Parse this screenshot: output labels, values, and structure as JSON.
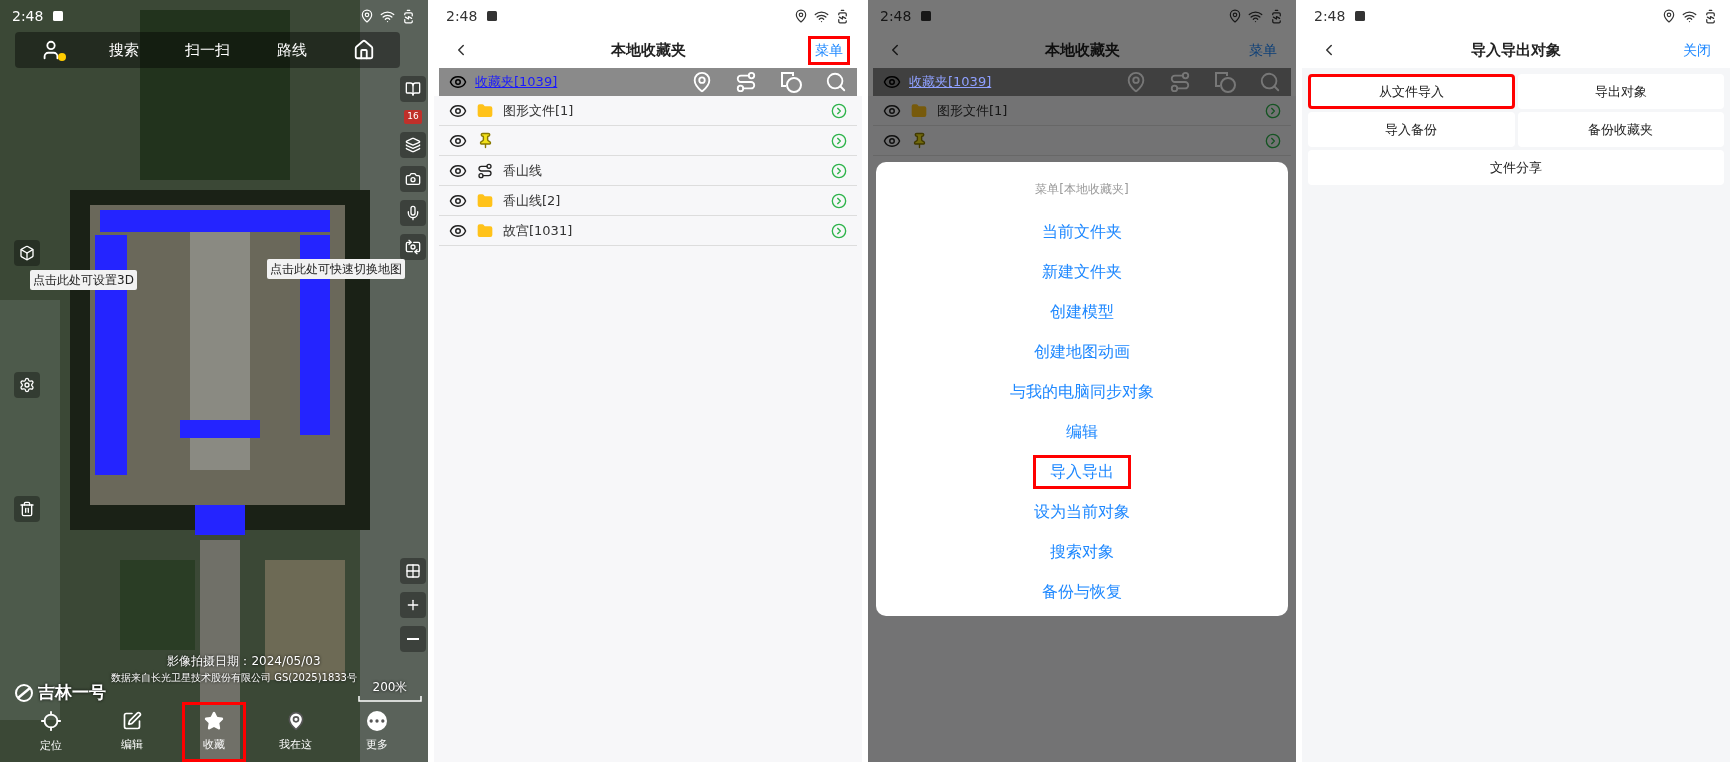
{
  "map_screen": {
    "status_bar": {
      "time": "2:48"
    },
    "top_tabs": [
      "搜索",
      "扫一扫",
      "路线"
    ],
    "zoom_badge": "16",
    "tooltips": {
      "mode_3d": "点击此处可设置3D",
      "map_switch": "点击此处可快速切换地图"
    },
    "imagery_date": "影像拍摄日期：2024/05/03",
    "credit": "数据来自长光卫星技术股份有限公司 GS(2025)1833号",
    "brand": "吉林一号",
    "scale": "200米",
    "bottom_nav": [
      {
        "kind": "locate",
        "label": "定位",
        "highlighted": false
      },
      {
        "kind": "edit",
        "label": "编辑",
        "highlighted": false
      },
      {
        "kind": "favorite",
        "label": "收藏",
        "highlighted": true
      },
      {
        "kind": "here",
        "label": "我在这",
        "highlighted": false
      },
      {
        "kind": "more",
        "label": "更多",
        "highlighted": false
      }
    ]
  },
  "favorites_screen": {
    "status_bar": {
      "time": "2:48"
    },
    "header": {
      "title": "本地收藏夹",
      "action": {
        "label": "菜单",
        "highlighted": true
      }
    },
    "folder_bar": {
      "title": "收藏夹[1039]"
    },
    "items": [
      {
        "kind": "folder",
        "label": "图形文件[1]"
      },
      {
        "kind": "pin"
      },
      {
        "kind": "route",
        "label": "香山线"
      },
      {
        "kind": "folder",
        "label": "香山线[2]"
      },
      {
        "kind": "folder",
        "label": "故宫[1031]"
      }
    ]
  },
  "menu_screen": {
    "status_bar": {
      "time": "2:48"
    },
    "header": {
      "title": "本地收藏夹",
      "action": {
        "label": "菜单",
        "highlighted": false
      }
    },
    "folder_bar": {
      "title": "收藏夹[1039]"
    },
    "items": [
      {
        "kind": "folder",
        "label": "图形文件[1]"
      },
      {
        "kind": "pin"
      }
    ],
    "menu": {
      "title": "菜单[本地收藏夹]",
      "items": [
        {
          "label": "当前文件夹",
          "highlighted": false
        },
        {
          "label": "新建文件夹",
          "highlighted": false
        },
        {
          "label": "创建模型",
          "highlighted": false
        },
        {
          "label": "创建地图动画",
          "highlighted": false
        },
        {
          "label": "与我的电脑同步对象",
          "highlighted": false
        },
        {
          "label": "编辑",
          "highlighted": false
        },
        {
          "label": "导入导出",
          "highlighted": true
        },
        {
          "label": "设为当前对象",
          "highlighted": false
        },
        {
          "label": "搜索对象",
          "highlighted": false
        },
        {
          "label": "备份与恢复",
          "highlighted": false
        }
      ]
    }
  },
  "import_export_screen": {
    "status_bar": {
      "time": "2:48"
    },
    "header": {
      "title": "导入导出对象",
      "action": {
        "label": "关闭",
        "highlighted": false
      }
    },
    "buttons": [
      {
        "kind": "half",
        "label": "从文件导入",
        "highlighted": true
      },
      {
        "kind": "half",
        "label": "导出对象",
        "highlighted": false
      },
      {
        "kind": "half",
        "label": "导入备份",
        "highlighted": false
      },
      {
        "kind": "half",
        "label": "备份收藏夹",
        "highlighted": false
      },
      {
        "kind": "full",
        "label": "文件分享",
        "highlighted": false
      }
    ]
  }
}
